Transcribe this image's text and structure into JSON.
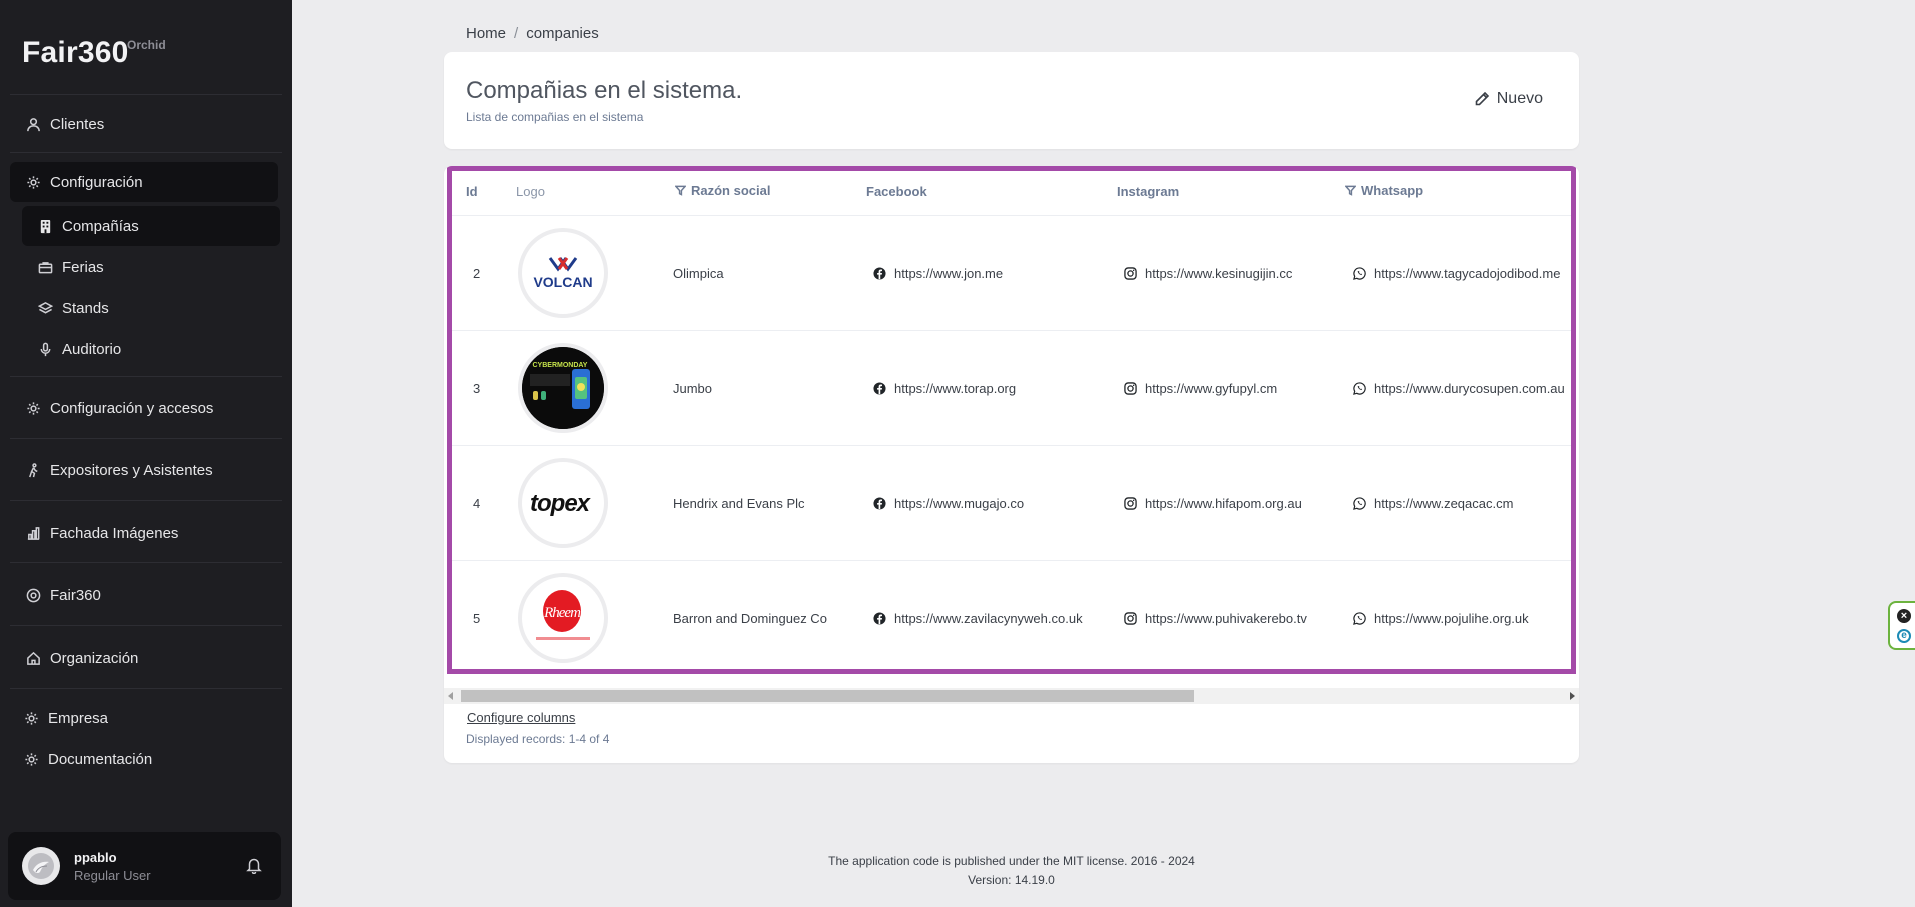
{
  "app": {
    "brand": "Fair360",
    "brand_sub": "Orchid"
  },
  "sidebar": {
    "items": [
      {
        "label": "Clientes",
        "icon": "user-icon"
      },
      {
        "label": "Configuración",
        "icon": "gear-icon"
      },
      {
        "label": "Compañías",
        "icon": "building-icon"
      },
      {
        "label": "Ferias",
        "icon": "briefcase-icon"
      },
      {
        "label": "Stands",
        "icon": "layers-icon"
      },
      {
        "label": "Auditorio",
        "icon": "microphone-icon"
      },
      {
        "label": "Configuración y accesos",
        "icon": "gear-icon"
      },
      {
        "label": "Expositores y Asistentes",
        "icon": "walking-person-icon"
      },
      {
        "label": "Fachada Imágenes",
        "icon": "bar-chart-icon"
      },
      {
        "label": "Fair360",
        "icon": "target-icon"
      },
      {
        "label": "Organización",
        "icon": "home-icon"
      },
      {
        "label": "Empresa",
        "icon": "gear-icon"
      },
      {
        "label": "Documentación",
        "icon": "gear-icon"
      }
    ]
  },
  "user": {
    "name": "ppablo",
    "role": "Regular User"
  },
  "breadcrumb": {
    "home": "Home",
    "sep": "/",
    "current": "companies"
  },
  "header": {
    "title": "Compañias en el sistema.",
    "subtitle": "Lista de compañias en el sistema",
    "new_button": "Nuevo"
  },
  "table": {
    "columns": [
      "Id",
      "Logo",
      "Razón social",
      "Facebook",
      "Instagram",
      "Whatsapp"
    ],
    "rows": [
      {
        "id": "2",
        "name": "Olimpica",
        "facebook": "https://www.jon.me",
        "instagram": "https://www.kesinugijin.cc",
        "whatsapp": "https://www.tagycadojodibod.me",
        "logo": "VOLCAN"
      },
      {
        "id": "3",
        "name": "Jumbo",
        "facebook": "https://www.torap.org",
        "instagram": "https://www.gyfupyl.cm",
        "whatsapp": "https://www.durycosupen.com.au",
        "logo": "CYBERMONDAY"
      },
      {
        "id": "4",
        "name": "Hendrix and Evans Plc",
        "facebook": "https://www.mugajo.co",
        "instagram": "https://www.hifapom.org.au",
        "whatsapp": "https://www.zeqacac.cm",
        "logo": "topex"
      },
      {
        "id": "5",
        "name": "Barron and Dominguez Co",
        "facebook": "https://www.zavilacynyweh.co.uk",
        "instagram": "https://www.puhivakerebo.tv",
        "whatsapp": "https://www.pojulihe.org.uk",
        "logo": "Rheem"
      }
    ],
    "configure_columns": "Configure columns",
    "displayed_records": "Displayed records: 1-4 of 4"
  },
  "footer": {
    "line1": "The application code is published under the MIT license. 2016 - 2024",
    "line2": "Version: 14.19.0"
  },
  "colors": {
    "sidebar_bg": "#1e1e22",
    "highlight_border": "#a44aa8",
    "page_bg": "#ececee"
  }
}
